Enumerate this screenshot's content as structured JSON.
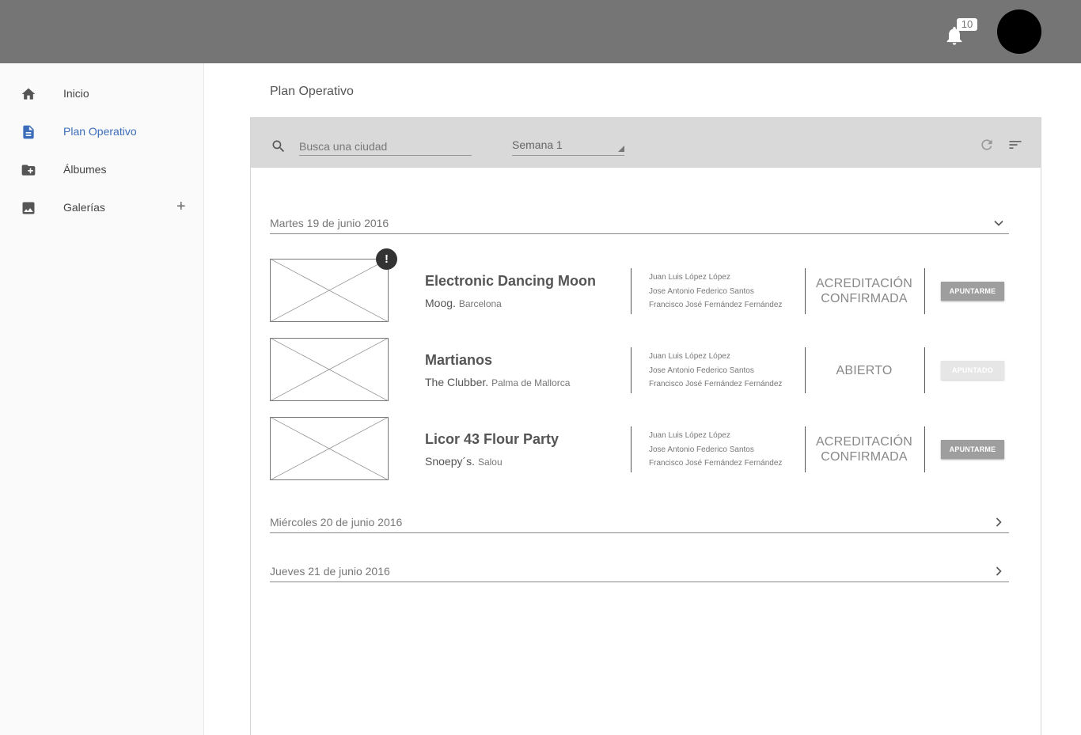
{
  "header": {
    "notification_count": "10"
  },
  "sidebar": {
    "items": [
      {
        "label": "Inicio",
        "icon": "home-icon"
      },
      {
        "label": "Plan Operativo",
        "icon": "document-icon",
        "active": true
      },
      {
        "label": "Álbumes",
        "icon": "folder-add-icon"
      },
      {
        "label": "Galerías",
        "icon": "image-icon"
      }
    ],
    "add_symbol": "+"
  },
  "page": {
    "title": "Plan Operativo"
  },
  "toolbar": {
    "search_placeholder": "Busca una ciudad",
    "week": "Semana 1"
  },
  "days": [
    {
      "label": "Martes 19 de junio 2016",
      "expanded": true,
      "events": [
        {
          "title": "Electronic Dancing Moon",
          "venue": "Moog",
          "city": "Barcelona",
          "alert": "!",
          "people": [
            "Juan Luis López López",
            "Jose Antonio Federico Santos",
            "Francisco José Fernández Fernández"
          ],
          "status_line1": "ACREDITACIÓN",
          "status_line2": "CONFIRMADA",
          "button": "APUNTARME"
        },
        {
          "title": "Martianos",
          "venue": "The Clubber",
          "city": "Palma de Mallorca",
          "people": [
            "Juan Luis López López",
            "Jose Antonio Federico Santos",
            "Francisco José Fernández Fernández"
          ],
          "status_line1": "ABIERTO",
          "status_line2": "",
          "button": "APUNTADO"
        },
        {
          "title": "Licor 43 Flour Party",
          "venue": "Snoepy´s",
          "city": "Salou",
          "people": [
            "Juan Luis López López",
            "Jose Antonio Federico Santos",
            "Francisco José Fernández Fernández"
          ],
          "status_line1": "ACREDITACIÓN",
          "status_line2": "CONFIRMADA",
          "button": "APUNTARME"
        }
      ]
    },
    {
      "label": "Miércoles 20 de junio 2016",
      "expanded": false
    },
    {
      "label": "Jueves 21 de junio 2016",
      "expanded": false
    }
  ],
  "colors": {
    "topbar": "#757575",
    "active_nav": "#3b6dba",
    "toolbar": "#d9d9d9"
  }
}
